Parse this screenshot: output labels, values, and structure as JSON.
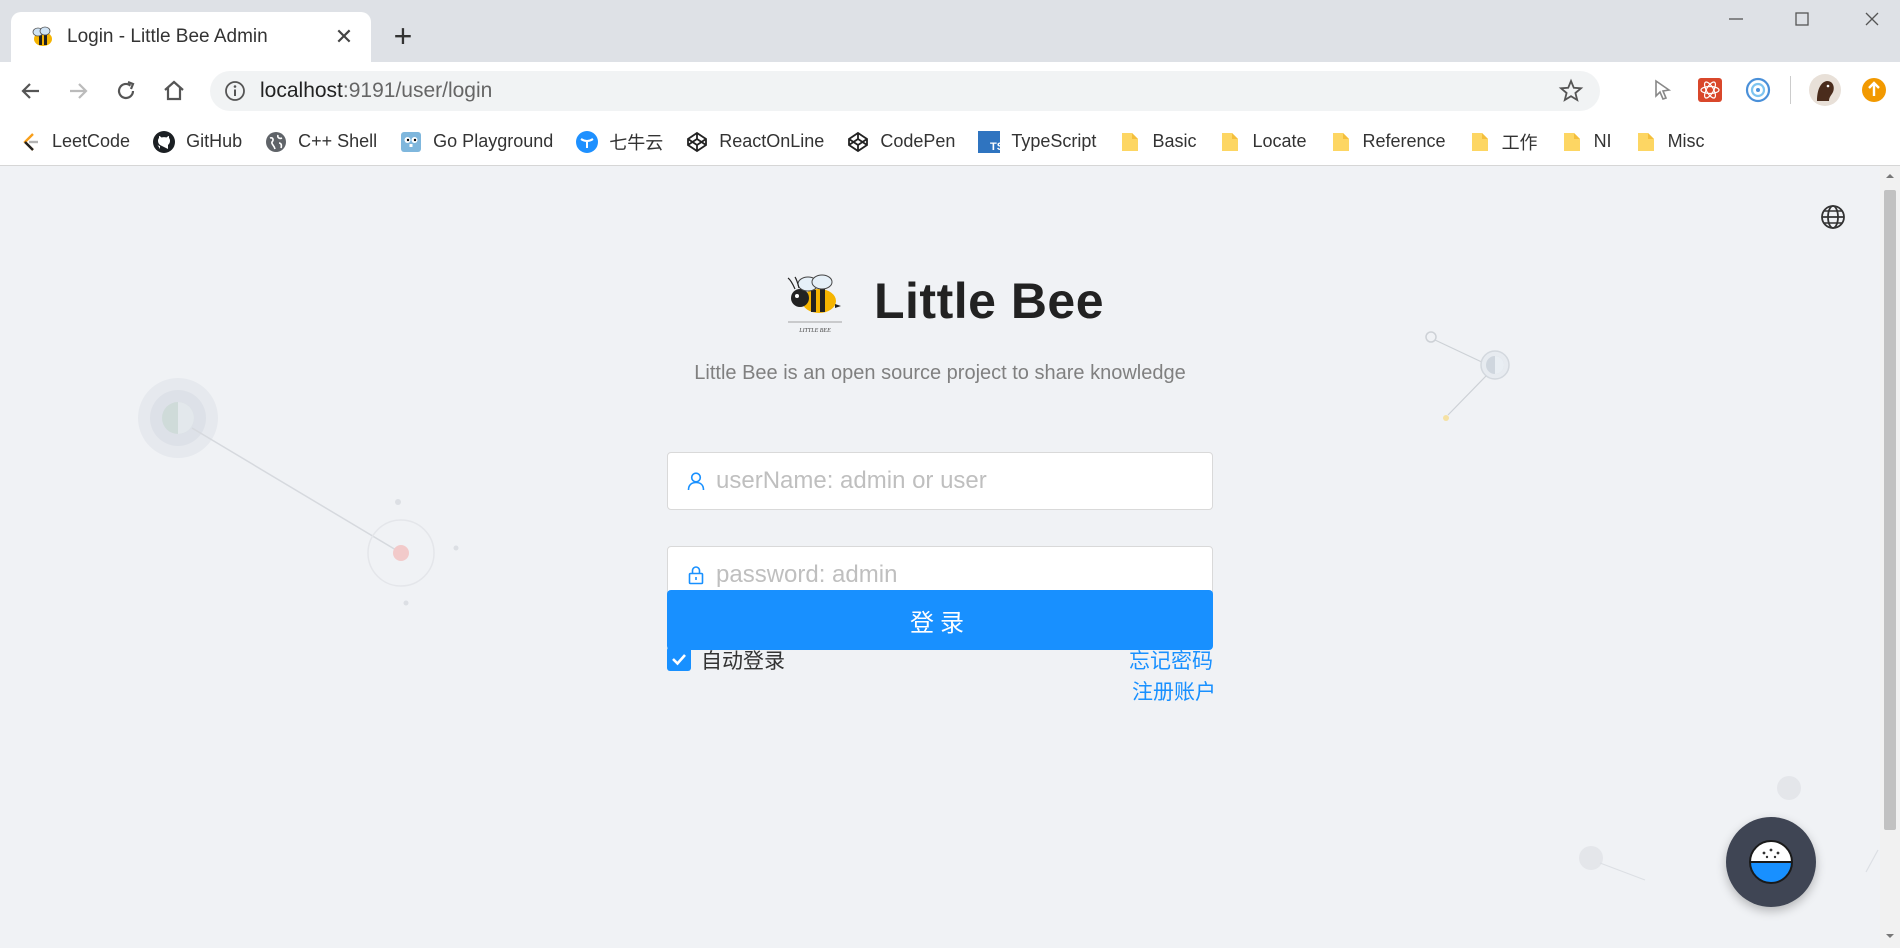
{
  "browser": {
    "tab_title": "Login - Little Bee Admin",
    "tab_close": "✕",
    "new_tab": "+",
    "url_host": "localhost",
    "url_rest": ":9191/user/login"
  },
  "bookmarks": [
    {
      "label": "LeetCode",
      "icon": "leetcode-icon"
    },
    {
      "label": "GitHub",
      "icon": "github-icon"
    },
    {
      "label": "C++ Shell",
      "icon": "globe-icon"
    },
    {
      "label": "Go Playground",
      "icon": "gopher-icon"
    },
    {
      "label": "七牛云",
      "icon": "qiniu-icon"
    },
    {
      "label": "ReactOnLine",
      "icon": "codepen-icon"
    },
    {
      "label": "CodePen",
      "icon": "codepen-icon"
    },
    {
      "label": "TypeScript",
      "icon": "typescript-icon"
    },
    {
      "label": "Basic",
      "icon": "folder-icon"
    },
    {
      "label": "Locate",
      "icon": "folder-icon"
    },
    {
      "label": "Reference",
      "icon": "folder-icon"
    },
    {
      "label": "工作",
      "icon": "folder-icon"
    },
    {
      "label": "NI",
      "icon": "folder-icon"
    },
    {
      "label": "Misc",
      "icon": "folder-icon"
    }
  ],
  "app": {
    "title": "Little Bee",
    "logo_caption": "LITTLE BEE",
    "description": "Little Bee is an open source project to share knowledge"
  },
  "login_form": {
    "username_placeholder": "userName: admin or user",
    "username_value": "",
    "password_placeholder": "password: admin",
    "password_value": "",
    "remember_label": "自动登录",
    "remember_checked": true,
    "forgot_label": "忘记密码",
    "submit_label": "登录",
    "register_label": "注册账户"
  },
  "colors": {
    "primary": "#1890ff",
    "page_bg": "#f0f2f5",
    "float_button": "#3f4554"
  }
}
